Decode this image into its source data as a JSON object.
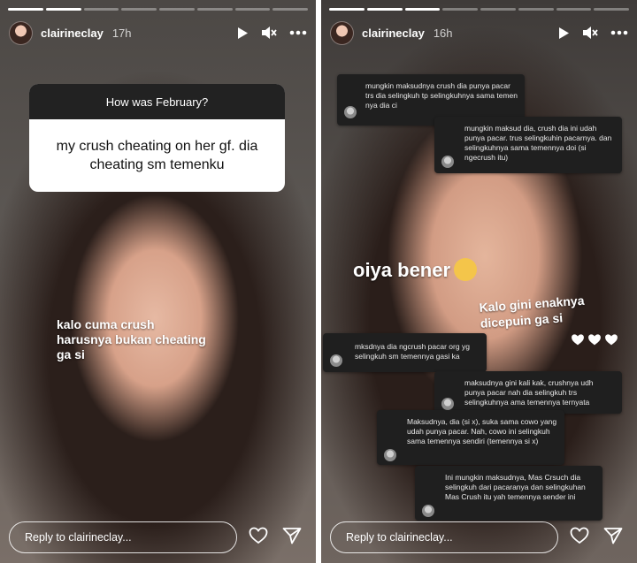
{
  "stories": [
    {
      "id": "left",
      "username": "clairineclay",
      "time_ago": "17h",
      "question_header": "How was February?",
      "question_answer": "my crush cheating on her gf. dia cheating sm temenku",
      "caption": "kalo cuma crush harusnya bukan cheating ga si",
      "reply_placeholder": "Reply to clairineclay..."
    },
    {
      "id": "right",
      "username": "clairineclay",
      "time_ago": "16h",
      "caption_main": "oiya bener",
      "caption_secondary": "Kalo gini enaknya dicepuin ga si",
      "hearts_count": 3,
      "reply_placeholder": "Reply to clairineclay...",
      "messages": [
        {
          "text": "mungkin maksudnya crush dia punya pacar trs dia selingkuh tp selingkuhnya sama temen nya dia ci"
        },
        {
          "text": "mungkin maksud dia, crush dia ini udah punya pacar. trus selingkuhin pacarnya. dan selingkuhnya sama temennya doi (si ngecrush itu)"
        },
        {
          "text": "mksdnya dia ngcrush pacar org yg selingkuh sm temennya gasi ka"
        },
        {
          "text": "maksudnya gini kali kak, crushnya udh punya pacar nah dia selingkuh trs selingkuhnya ama temennya ternyata"
        },
        {
          "text": "Maksudnya, dia (si x), suka sama cowo yang udah punya pacar. Nah, cowo ini selingkuh sama temennya sendiri (temennya si x)"
        },
        {
          "text": "Ini mungkin maksudnya, Mas Crsuch dia selingkuh dari pacaranya dan selingkuhan Mas Crush itu yah temennya sender ini"
        }
      ]
    }
  ],
  "icons": {
    "play": "play-icon",
    "mute": "speaker-muted-icon",
    "more": "more-icon",
    "like": "heart-icon",
    "share": "paper-plane-icon"
  },
  "colors": {
    "question_header_bg": "#222222",
    "dm_bg": "#1f1f1f",
    "text_white": "#ffffff"
  }
}
